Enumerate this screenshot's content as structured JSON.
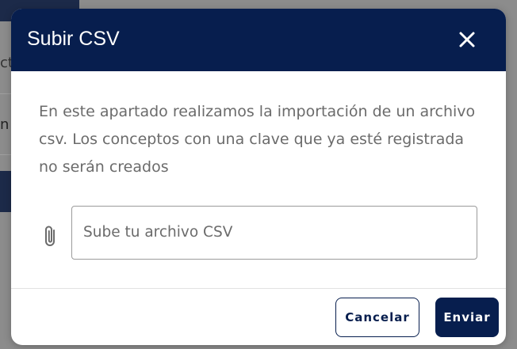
{
  "background": {
    "row1_fragment": "ct",
    "row2_fragment": "n"
  },
  "modal": {
    "title": "Subir CSV",
    "close_icon": "close-icon",
    "description": "En este apartado realizamos la importación de un archivo csv. Los conceptos con una clave que ya esté registrada no serán creados",
    "upload": {
      "icon": "paperclip-icon",
      "placeholder": "Sube tu archivo CSV"
    },
    "buttons": {
      "cancel": "Cancelar",
      "send": "Enviar"
    },
    "colors": {
      "header": "#071e4e",
      "body_text": "#6b6b6b"
    }
  }
}
